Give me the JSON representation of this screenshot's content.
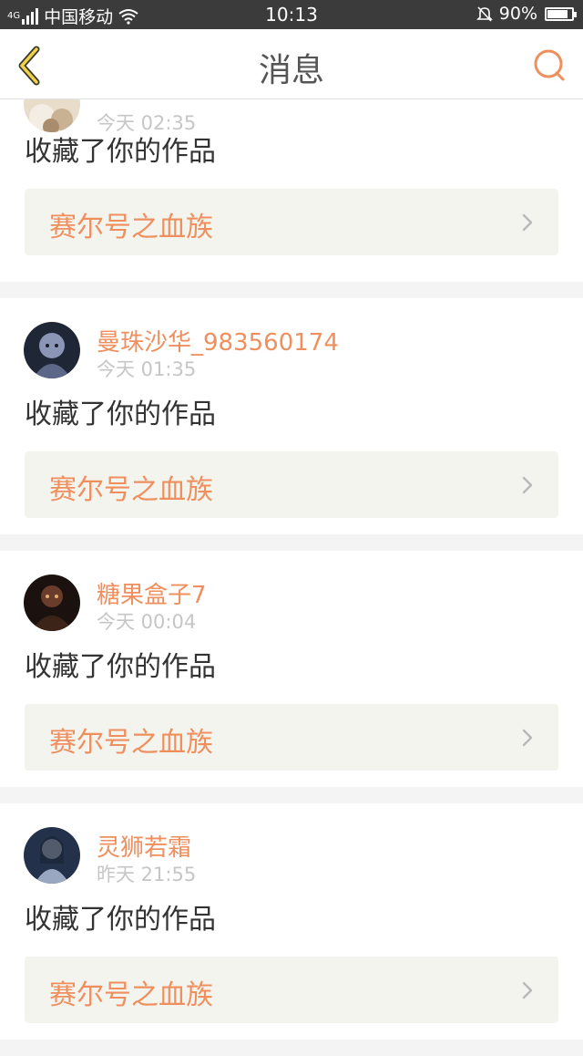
{
  "status_bar": {
    "carrier": "中国移动",
    "network": "4G",
    "time": "10:13",
    "battery": "90%",
    "battery_level": 0.9
  },
  "nav": {
    "title": "消息",
    "back_icon": "back-chevron-icon",
    "search_icon": "search-icon",
    "accent_color": "#ef8f5e"
  },
  "messages": [
    {
      "username": "",
      "time": "今天 02:35",
      "action": "收藏了你的作品",
      "work_title": "赛尔号之血族"
    },
    {
      "username": "曼珠沙华_983560174",
      "time": "今天 01:35",
      "action": "收藏了你的作品",
      "work_title": "赛尔号之血族"
    },
    {
      "username": "糖果盒子7",
      "time": "今天 00:04",
      "action": "收藏了你的作品",
      "work_title": "赛尔号之血族"
    },
    {
      "username": "灵狮若霜",
      "time": "昨天 21:55",
      "action": "收藏了你的作品",
      "work_title": "赛尔号之血族"
    }
  ]
}
